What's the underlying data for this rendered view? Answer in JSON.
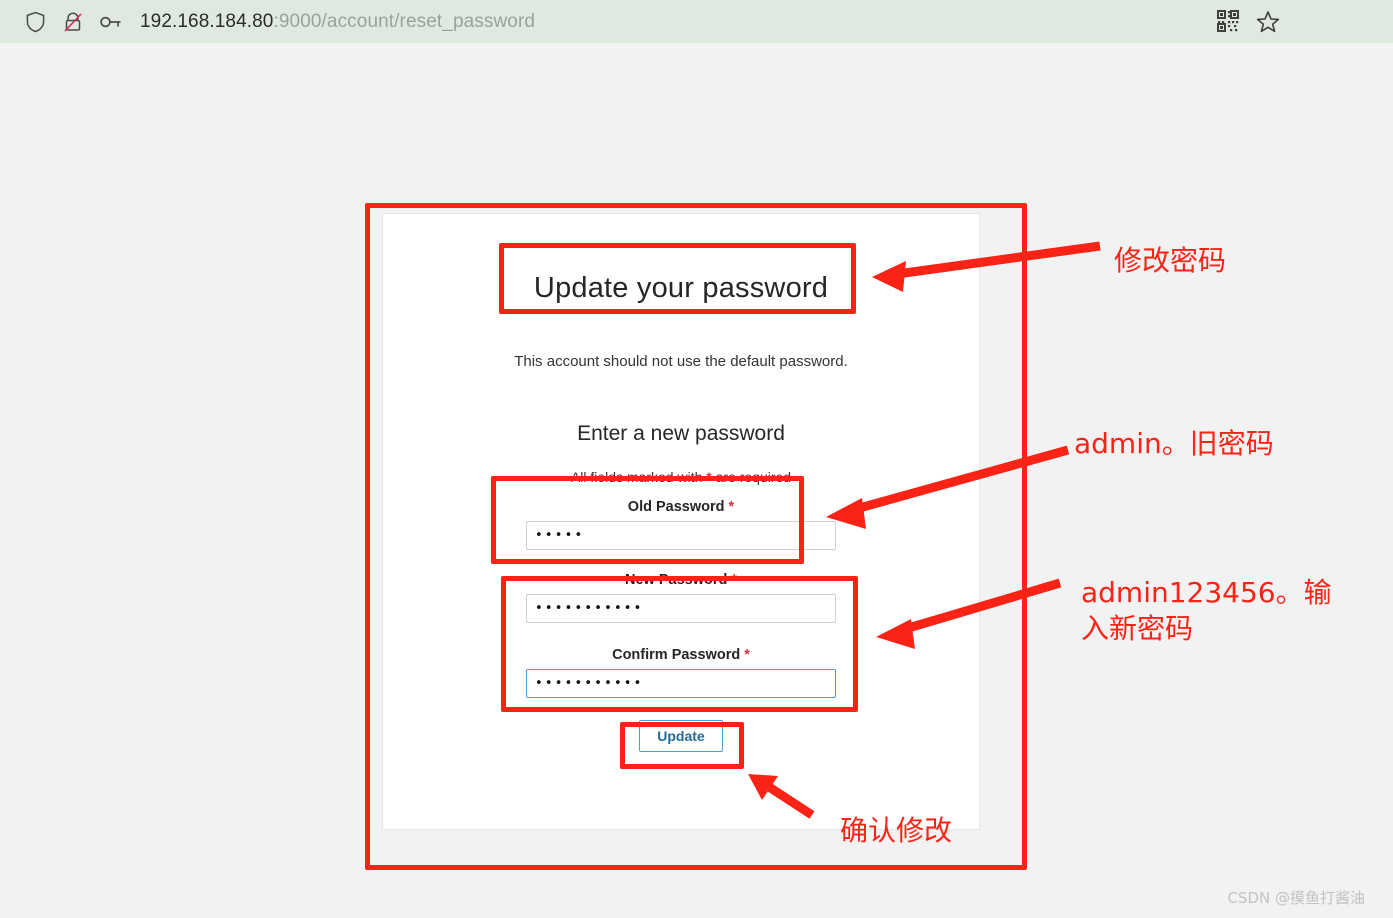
{
  "browser": {
    "url_host": "192.168.184.80",
    "url_rest": ":9000/account/reset_password",
    "icons": [
      "shield-icon",
      "tracker-blocked-icon",
      "key-icon",
      "qr-code-icon",
      "bookmark-star-icon"
    ]
  },
  "page": {
    "title": "Update your password",
    "subtitle": "This account should not use the default password.",
    "section_title": "Enter a new password",
    "required_note_prefix": "All fields marked with ",
    "required_note_star": "*",
    "required_note_suffix": " are required",
    "fields": [
      {
        "name": "old-password",
        "label": "Old Password",
        "required_marker": "*",
        "value": "•••••",
        "focused": false
      },
      {
        "name": "new-password",
        "label": "New Password",
        "required_marker": "*",
        "value": "•••••••••••",
        "focused": false
      },
      {
        "name": "confirm-password",
        "label": "Confirm Password",
        "required_marker": "*",
        "value": "•••••••••••",
        "focused": true
      }
    ],
    "submit_label": "Update"
  },
  "annotations": {
    "accent_color": "#fb2316",
    "note_1": "修改密码",
    "note_2": "admin。旧密码",
    "note_3": "admin123456。输\n入新密码",
    "note_4": "确认修改"
  },
  "watermark": "CSDN @摸鱼打酱油"
}
